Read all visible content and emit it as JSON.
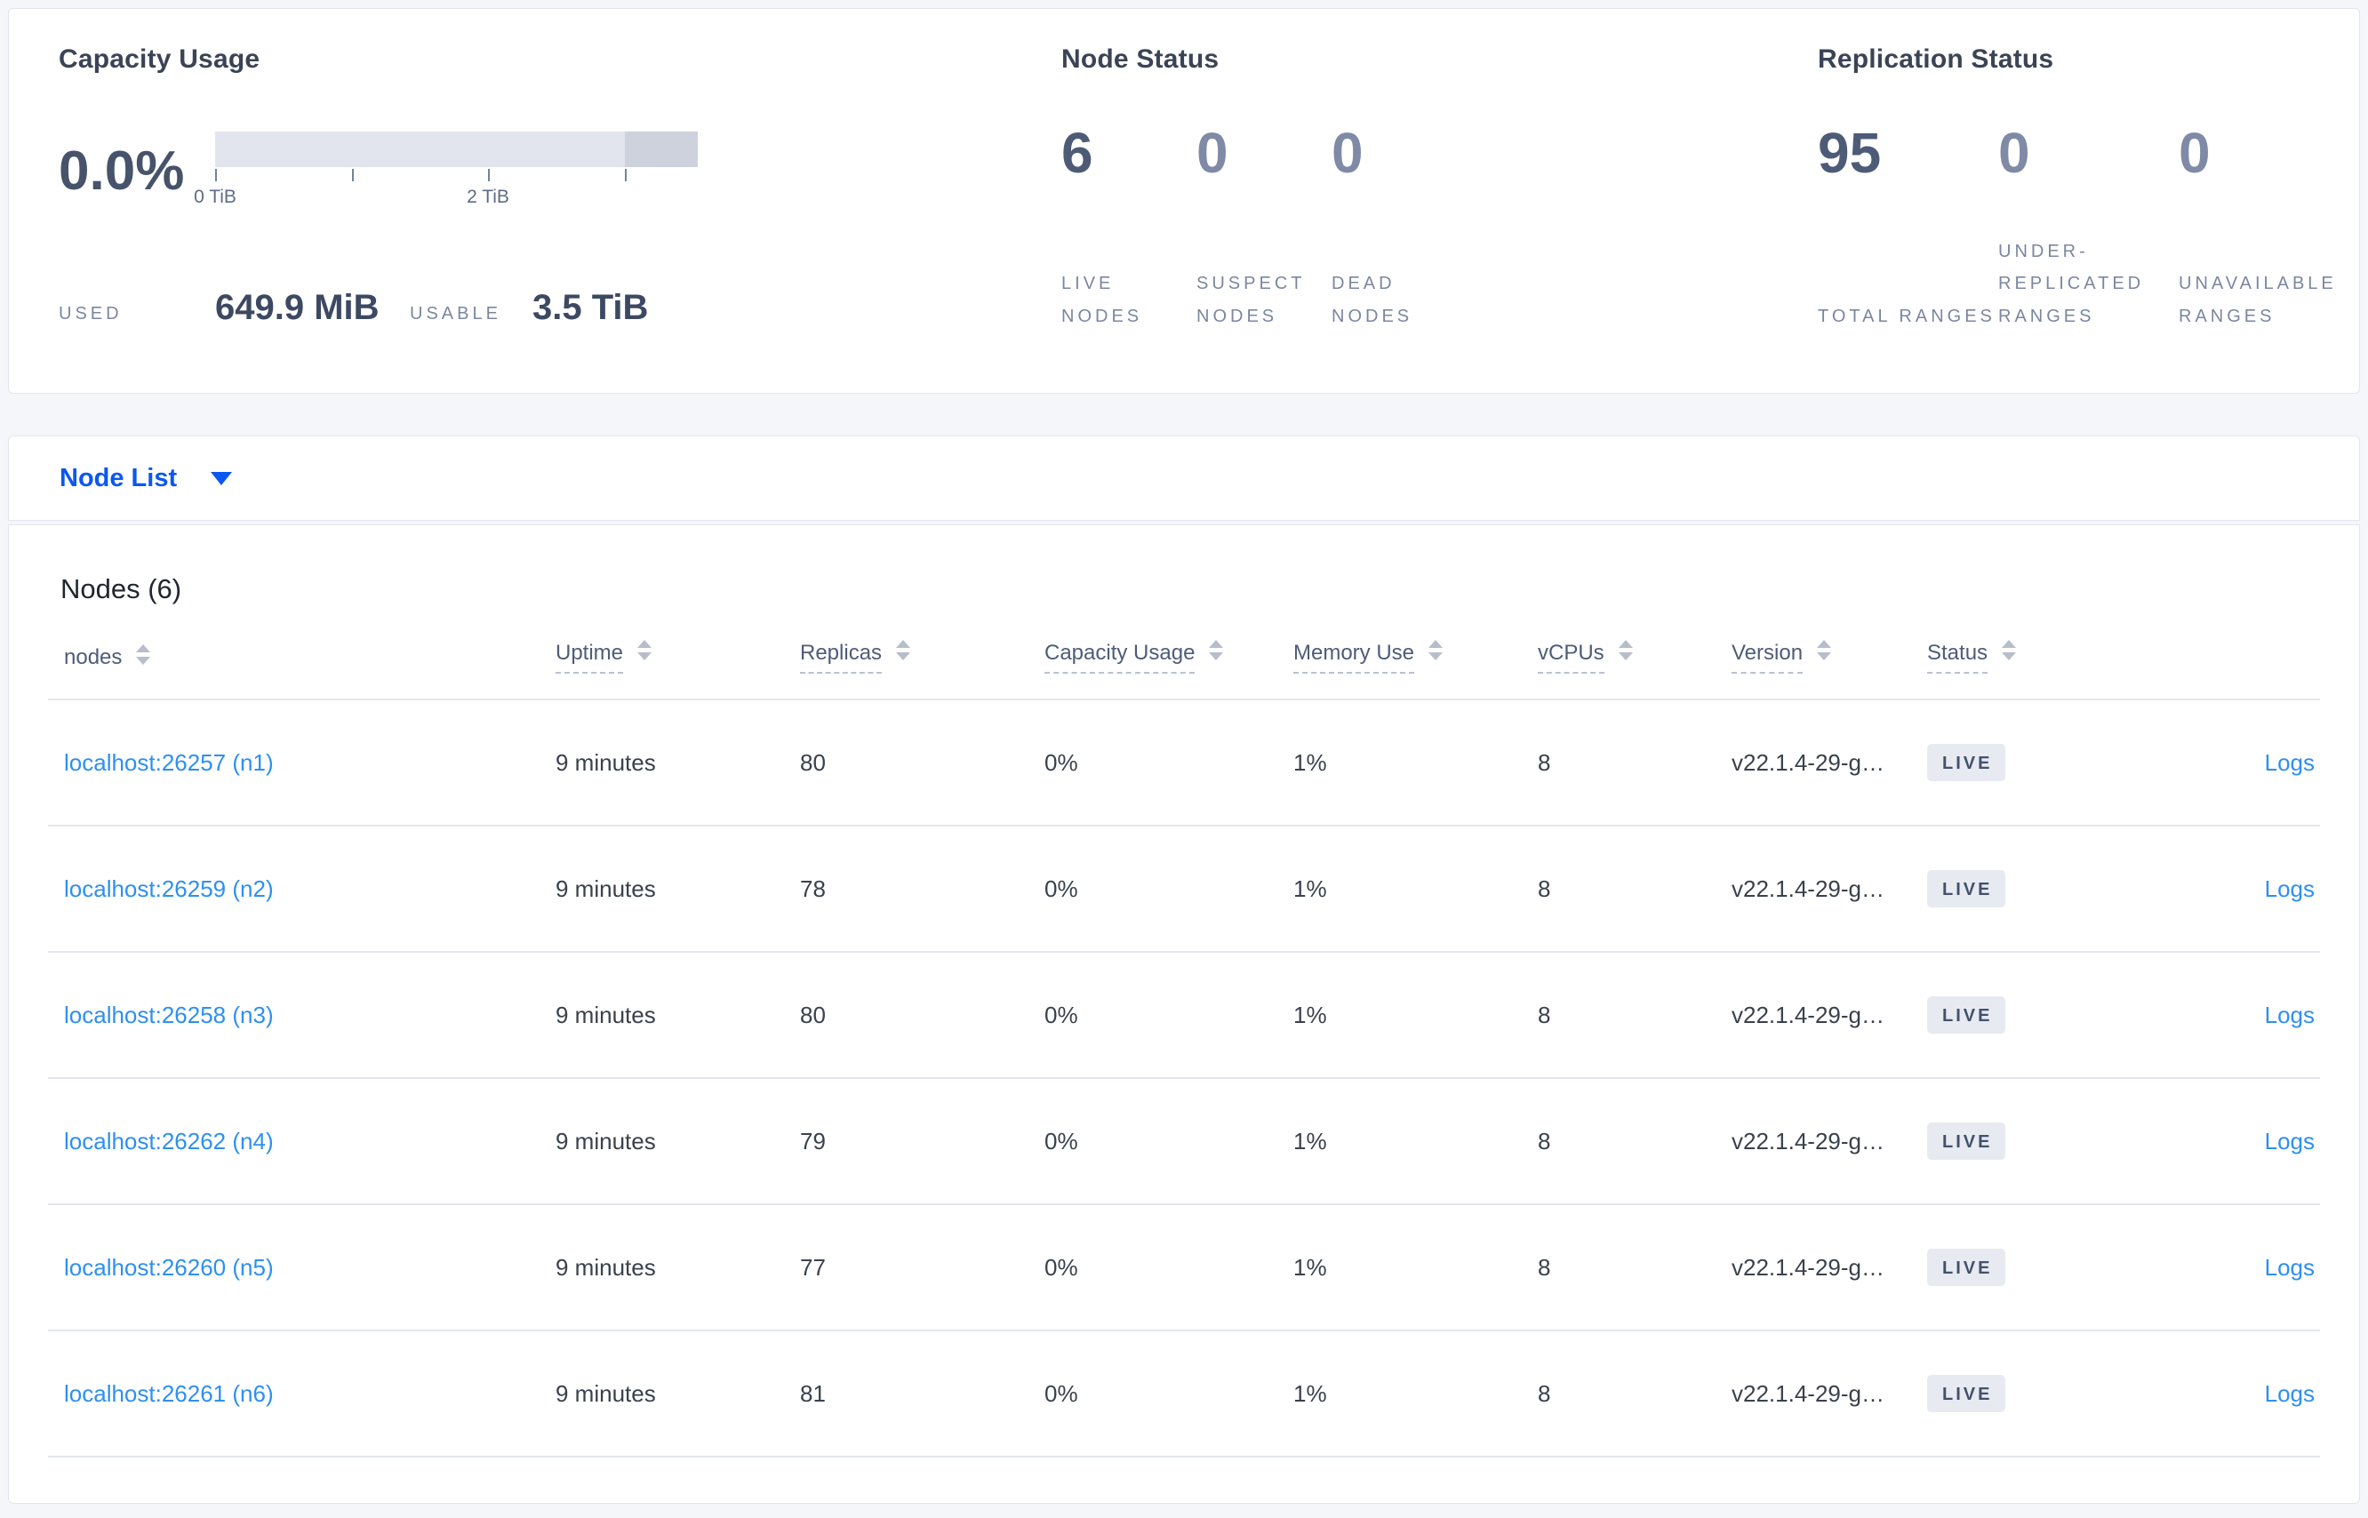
{
  "panels": {
    "capacity": {
      "title": "Capacity Usage",
      "percent": "0.0%",
      "tick_labels": [
        "0 TiB",
        "2 TiB"
      ],
      "used_label": "USED",
      "used_value": "649.9 MiB",
      "usable_label": "USABLE",
      "usable_value": "3.5 TiB"
    },
    "node_status": {
      "title": "Node Status",
      "stats": [
        {
          "value": "6",
          "label": "LIVE NODES"
        },
        {
          "value": "0",
          "label": "SUSPECT NODES"
        },
        {
          "value": "0",
          "label": "DEAD NODES"
        }
      ]
    },
    "replication": {
      "title": "Replication Status",
      "stats": [
        {
          "value": "95",
          "label": "TOTAL RANGES"
        },
        {
          "value": "0",
          "label": "UNDER-REPLICATED RANGES"
        },
        {
          "value": "0",
          "label": "UNAVAILABLE RANGES"
        }
      ]
    }
  },
  "view_selector": {
    "label": "Node List"
  },
  "table": {
    "title": "Nodes (6)",
    "columns": [
      {
        "label": "nodes"
      },
      {
        "label": "Uptime"
      },
      {
        "label": "Replicas"
      },
      {
        "label": "Capacity Usage"
      },
      {
        "label": "Memory Use"
      },
      {
        "label": "vCPUs"
      },
      {
        "label": "Version"
      },
      {
        "label": "Status"
      }
    ],
    "rows": [
      {
        "node": "localhost:26257 (n1)",
        "uptime": "9 minutes",
        "replicas": "80",
        "capacity": "0%",
        "memory": "1%",
        "vcpus": "8",
        "version": "v22.1.4-29-g…",
        "status": "LIVE",
        "logs": "Logs"
      },
      {
        "node": "localhost:26259 (n2)",
        "uptime": "9 minutes",
        "replicas": "78",
        "capacity": "0%",
        "memory": "1%",
        "vcpus": "8",
        "version": "v22.1.4-29-g…",
        "status": "LIVE",
        "logs": "Logs"
      },
      {
        "node": "localhost:26258 (n3)",
        "uptime": "9 minutes",
        "replicas": "80",
        "capacity": "0%",
        "memory": "1%",
        "vcpus": "8",
        "version": "v22.1.4-29-g…",
        "status": "LIVE",
        "logs": "Logs"
      },
      {
        "node": "localhost:26262 (n4)",
        "uptime": "9 minutes",
        "replicas": "79",
        "capacity": "0%",
        "memory": "1%",
        "vcpus": "8",
        "version": "v22.1.4-29-g…",
        "status": "LIVE",
        "logs": "Logs"
      },
      {
        "node": "localhost:26260 (n5)",
        "uptime": "9 minutes",
        "replicas": "77",
        "capacity": "0%",
        "memory": "1%",
        "vcpus": "8",
        "version": "v22.1.4-29-g…",
        "status": "LIVE",
        "logs": "Logs"
      },
      {
        "node": "localhost:26261 (n6)",
        "uptime": "9 minutes",
        "replicas": "81",
        "capacity": "0%",
        "memory": "1%",
        "vcpus": "8",
        "version": "v22.1.4-29-g…",
        "status": "LIVE",
        "logs": "Logs"
      }
    ]
  }
}
